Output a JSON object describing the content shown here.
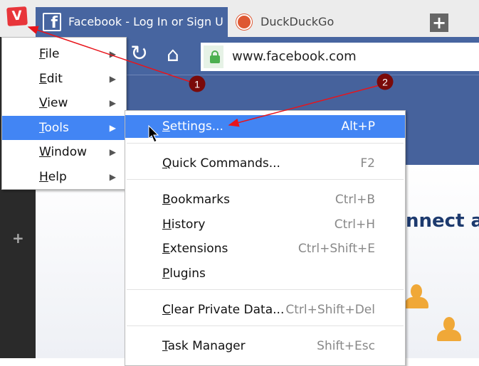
{
  "tabs": [
    {
      "label": "Facebook - Log In or Sign U",
      "icon": "facebook-icon",
      "active": true
    },
    {
      "label": "DuckDuckGo",
      "icon": "duckduckgo-icon",
      "active": false
    }
  ],
  "logo_letter": "V",
  "new_tab_label": "+",
  "address": {
    "url": "www.facebook.com"
  },
  "sidebar": {
    "add_label": "+"
  },
  "page": {
    "heading_fragment": "nnect ar"
  },
  "main_menu": [
    {
      "key": "F",
      "rest": "ile",
      "hl": false
    },
    {
      "key": "E",
      "rest": "dit",
      "hl": false
    },
    {
      "key": "V",
      "rest": "iew",
      "hl": false
    },
    {
      "key": "T",
      "rest": "ools",
      "hl": true
    },
    {
      "key": "W",
      "rest": "indow",
      "hl": false
    },
    {
      "key": "H",
      "rest": "elp",
      "hl": false
    }
  ],
  "tools_menu": [
    {
      "key": "S",
      "rest": "ettings...",
      "shortcut": "Alt+P"
    },
    {
      "key": "Q",
      "rest": "uick Commands...",
      "shortcut": "F2"
    },
    {
      "key": "B",
      "rest": "ookmarks",
      "shortcut": "Ctrl+B"
    },
    {
      "key": "H",
      "rest": "istory",
      "shortcut": "Ctrl+H"
    },
    {
      "key": "E",
      "rest": "xtensions",
      "shortcut": "Ctrl+Shift+E"
    },
    {
      "key": "P",
      "rest": "lugins",
      "shortcut": ""
    },
    {
      "key": "C",
      "rest": "lear Private Data...",
      "shortcut": "Ctrl+Shift+Del"
    },
    {
      "key": "T",
      "rest": "ask Manager",
      "shortcut": "Shift+Esc"
    }
  ],
  "annotations": [
    {
      "label": "1"
    },
    {
      "label": "2"
    }
  ],
  "colors": {
    "accent": "#4285f4",
    "facebook": "#4765a0",
    "annotation": "#e8141b",
    "badge": "#7a0a0a"
  }
}
